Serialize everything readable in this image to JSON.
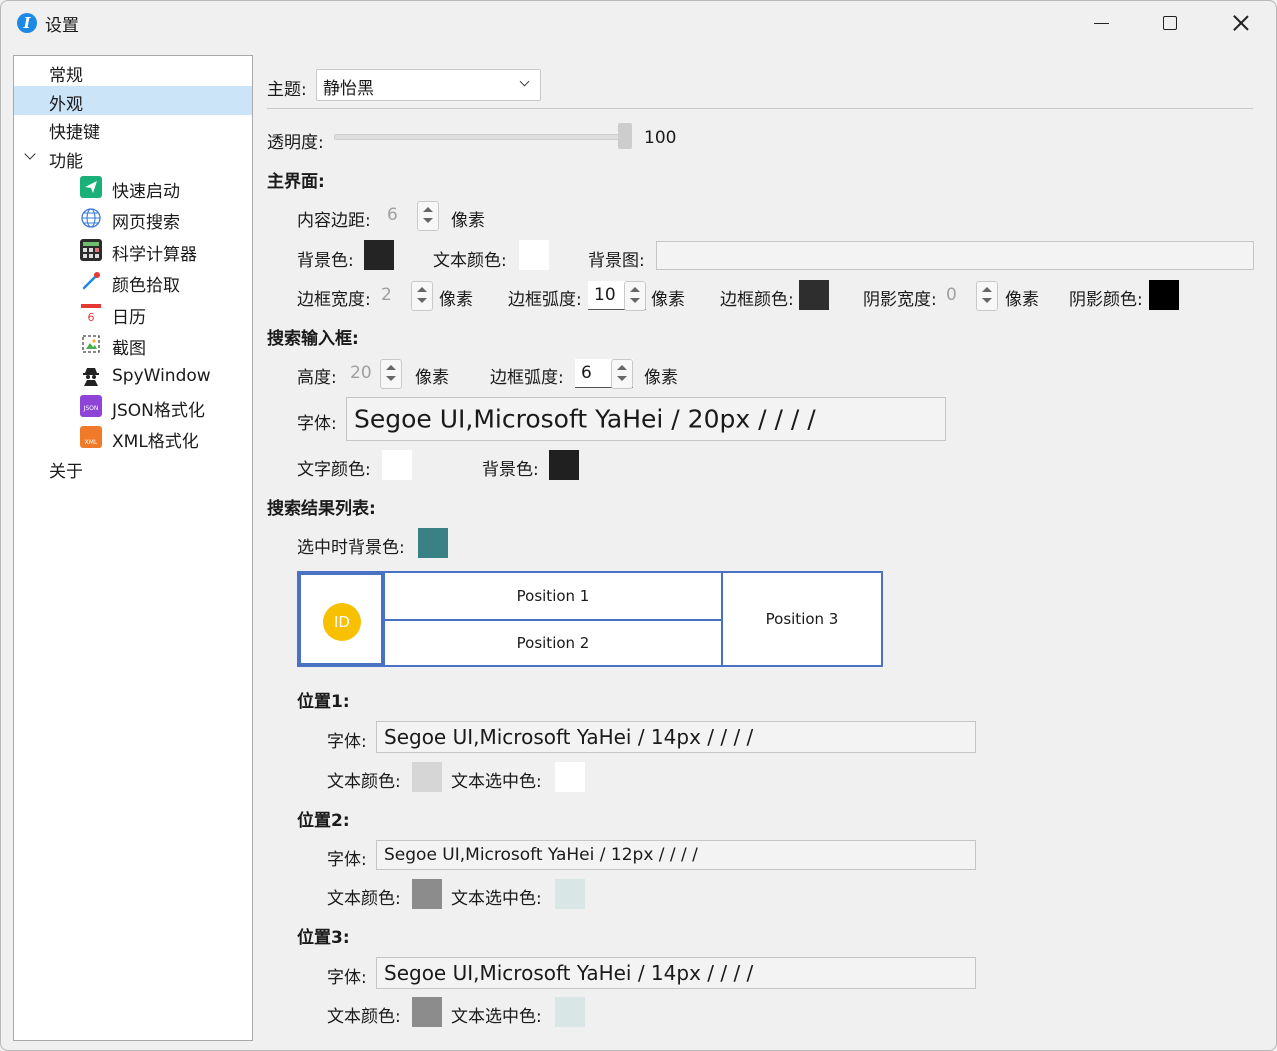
{
  "window": {
    "title": "设置",
    "app_icon_glyph": "I",
    "controls": [
      "minimize-icon",
      "maximize-icon",
      "close-icon"
    ]
  },
  "sidebar": {
    "items": [
      {
        "label": "常规"
      },
      {
        "label": "外观",
        "selected": true
      },
      {
        "label": "快捷键"
      },
      {
        "label": "功能",
        "expanded": true,
        "icon": "chevron-down-icon"
      },
      {
        "label": "快速启动",
        "icon": "paper-plane-icon",
        "icon_color": "#1ab07a"
      },
      {
        "label": "网页搜索",
        "icon": "globe-icon",
        "icon_color": "#3a7bd5"
      },
      {
        "label": "科学计算器",
        "icon": "calculator-icon",
        "icon_color": "#2e7d32"
      },
      {
        "label": "颜色拾取",
        "icon": "eyedropper-icon",
        "icon_color": "#1e88e5"
      },
      {
        "label": "日历",
        "icon": "calendar-icon",
        "icon_color": "#e53935",
        "icon_text": "6"
      },
      {
        "label": "截图",
        "icon": "screenshot-icon",
        "icon_color": "#444444"
      },
      {
        "label": "SpyWindow",
        "icon": "spy-icon",
        "icon_color": "#222222"
      },
      {
        "label": "JSON格式化",
        "icon": "json-file-icon",
        "icon_color": "#8e44d6",
        "icon_text": "JSON"
      },
      {
        "label": "XML格式化",
        "icon": "xml-file-icon",
        "icon_color": "#f07a2a",
        "icon_text": "XML"
      },
      {
        "label": "关于"
      }
    ]
  },
  "theme": {
    "label": "主题:",
    "value": "静怡黑"
  },
  "opacity": {
    "label": "透明度:",
    "value": "100",
    "fraction": 1.0
  },
  "main_ui": {
    "title": "主界面:",
    "padding": {
      "label": "内容边距:",
      "value": "6",
      "unit": "像素"
    },
    "bg_color": {
      "label": "背景色:",
      "color": "#242424"
    },
    "text_color": {
      "label": "文本颜色:",
      "color": "#ffffff"
    },
    "bg_image": {
      "label": "背景图:",
      "value": ""
    },
    "border_width": {
      "label": "边框宽度:",
      "value": "2",
      "unit": "像素"
    },
    "border_radius": {
      "label": "边框弧度:",
      "value": "10",
      "unit": "像素"
    },
    "border_color": {
      "label": "边框颜色:",
      "color": "#2e2e2e"
    },
    "shadow_width": {
      "label": "阴影宽度:",
      "value": "0",
      "unit": "像素"
    },
    "shadow_color": {
      "label": "阴影颜色:",
      "color": "#000000"
    }
  },
  "search_box": {
    "title": "搜索输入框:",
    "height": {
      "label": "高度:",
      "value": "20",
      "unit": "像素"
    },
    "border_radius": {
      "label": "边框弧度:",
      "value": "6",
      "unit": "像素"
    },
    "font": {
      "label": "字体:",
      "value": "Segoe UI,Microsoft YaHei / 20px /  /  /  /"
    },
    "text_color": {
      "label": "文字颜色:",
      "color": "#ffffff"
    },
    "bg_color": {
      "label": "背景色:",
      "color": "#202020"
    }
  },
  "result_list": {
    "title": "搜索结果列表:",
    "selected_bg": {
      "label": "选中时背景色:",
      "color": "#3a8186"
    },
    "preview": {
      "id_label": "ID",
      "position1": "Position 1",
      "position2": "Position 2",
      "position3": "Position 3",
      "border_color": "#4a72c4",
      "id_color": "#f7c000"
    },
    "pos1": {
      "title": "位置1:",
      "font": {
        "label": "字体:",
        "value": "Segoe UI,Microsoft YaHei / 14px /  /  /  /"
      },
      "text_color": {
        "label": "文本颜色:",
        "color": "#d6d6d6"
      },
      "selected_color": {
        "label": "文本选中色:",
        "color": "#ffffff"
      }
    },
    "pos2": {
      "title": "位置2:",
      "font": {
        "label": "字体:",
        "value": "Segoe UI,Microsoft YaHei / 12px /  /  /  /"
      },
      "text_color": {
        "label": "文本颜色:",
        "color": "#8c8c8c"
      },
      "selected_color": {
        "label": "文本选中色:",
        "color": "#d9e6e6"
      }
    },
    "pos3": {
      "title": "位置3:",
      "font": {
        "label": "字体:",
        "value": "Segoe UI,Microsoft YaHei / 14px /  /  /  /"
      },
      "text_color": {
        "label": "文本颜色:",
        "color": "#8c8c8c"
      },
      "selected_color": {
        "label": "文本选中色:",
        "color": "#d9e6e6"
      }
    }
  }
}
